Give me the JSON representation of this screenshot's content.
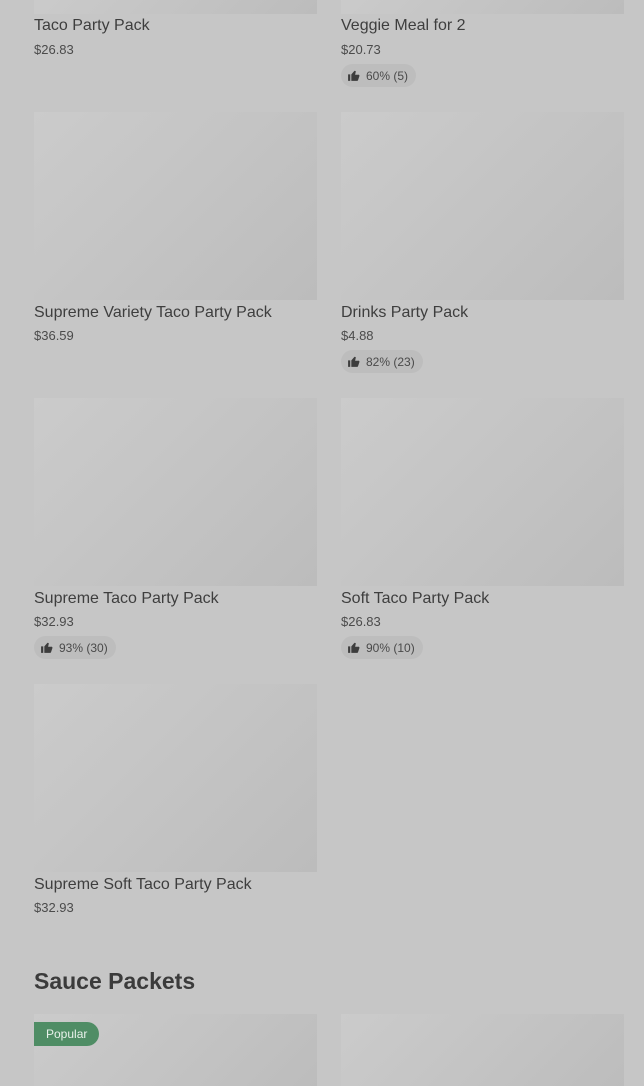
{
  "products": [
    {
      "name": "Taco Party Pack",
      "price": "$26.83"
    },
    {
      "name": "Veggie Meal for 2",
      "price": "$20.73",
      "rating": "60% (5)"
    },
    {
      "name": "Supreme Variety Taco Party Pack",
      "price": "$36.59"
    },
    {
      "name": "Drinks Party Pack",
      "price": "$4.88",
      "rating": "82% (23)"
    },
    {
      "name": "Supreme Taco Party Pack",
      "price": "$32.93",
      "rating": "93% (30)"
    },
    {
      "name": "Soft Taco Party Pack",
      "price": "$26.83",
      "rating": "90% (10)"
    },
    {
      "name": "Supreme Soft Taco Party Pack",
      "price": "$32.93"
    }
  ],
  "sauce_section": {
    "title": "Sauce Packets",
    "badge": "Popular"
  },
  "icons": {
    "rating": "thumbs-up-icon"
  },
  "colors": {
    "background": "#c6c6c6",
    "image_placeholder": "#c4c4c4",
    "rating_pill": "#bdbdbd",
    "popular_badge": "#4f8d65"
  }
}
